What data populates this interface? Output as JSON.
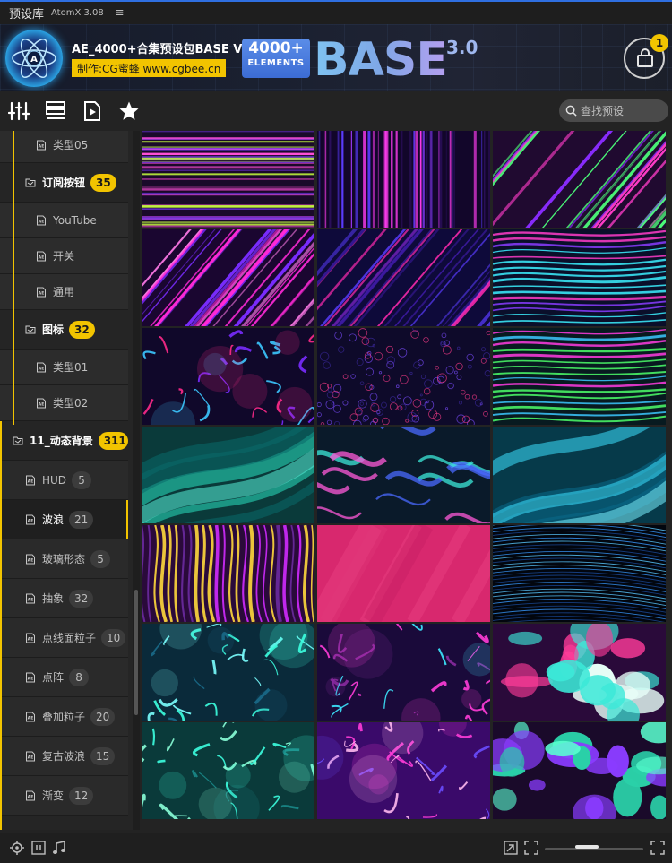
{
  "window": {
    "title": "预设库",
    "version": "AtomX 3.08",
    "menu_glyph": "≡"
  },
  "banner": {
    "logo_letter": "A",
    "title": "AE_4000+合集预设包BASE V3",
    "maker": "制作:CG蜜蜂 www.cgbee.cn",
    "tag_number": "4000+",
    "tag_word": "ELEMENTS",
    "base_word": "BASE",
    "base_version": "3.0",
    "cart_badge": "1"
  },
  "toolbar": {
    "icons": [
      "sliders-icon",
      "list-icon",
      "play-icon",
      "star-icon"
    ],
    "search_placeholder": "查找预设"
  },
  "sidebar": {
    "items": [
      {
        "label": "类型05",
        "level": "sub",
        "count": ""
      },
      {
        "label": "订阅按钮",
        "level": "group",
        "count": "35"
      },
      {
        "label": "YouTube",
        "level": "sub",
        "count": ""
      },
      {
        "label": "开关",
        "level": "sub",
        "count": ""
      },
      {
        "label": "通用",
        "level": "sub",
        "count": ""
      },
      {
        "label": "图标",
        "level": "group",
        "count": "32"
      },
      {
        "label": "类型01",
        "level": "sub",
        "count": ""
      },
      {
        "label": "类型02",
        "level": "sub",
        "count": ""
      },
      {
        "label": "11_动态背景",
        "level": "group",
        "count": "311"
      },
      {
        "label": "HUD",
        "level": "cat",
        "count": "5"
      },
      {
        "label": "波浪",
        "level": "cat",
        "count": "21",
        "selected": true
      },
      {
        "label": "玻璃形态",
        "level": "cat",
        "count": "5"
      },
      {
        "label": "抽象",
        "level": "cat",
        "count": "32"
      },
      {
        "label": "点线面粒子",
        "level": "cat",
        "count": "10"
      },
      {
        "label": "点阵",
        "level": "cat",
        "count": "8"
      },
      {
        "label": "叠加粒子",
        "level": "cat",
        "count": "20"
      },
      {
        "label": "复古波浪",
        "level": "cat",
        "count": "15"
      },
      {
        "label": "渐变",
        "level": "cat",
        "count": "12"
      }
    ]
  },
  "grid": {
    "thumbnails": [
      {
        "style": "h-streaks",
        "colors": [
          "#1a0a2a",
          "#7d3cff",
          "#c6ff3c",
          "#ff4fd8"
        ]
      },
      {
        "style": "v-streaks",
        "colors": [
          "#12062a",
          "#ff3cf0",
          "#5b3cff",
          "#2a0f5a"
        ]
      },
      {
        "style": "diag-streaks",
        "colors": [
          "#200a30",
          "#ff3cc8",
          "#4cff7a",
          "#8a2cff"
        ]
      },
      {
        "style": "diag-streaks",
        "colors": [
          "#1a0630",
          "#ff2ad8",
          "#7a2cff",
          "#ff7ae8"
        ]
      },
      {
        "style": "diag-streaks",
        "colors": [
          "#0e0a3a",
          "#ff2ab0",
          "#5a3cff",
          "#3c1aa0"
        ]
      },
      {
        "style": "h-waves",
        "colors": [
          "#0a0f2a",
          "#ff3cc8",
          "#3cf0ff",
          "#8a3cff"
        ]
      },
      {
        "style": "cells",
        "colors": [
          "#10082a",
          "#3cc8ff",
          "#ff2a8a",
          "#7a2cff"
        ]
      },
      {
        "style": "noise",
        "colors": [
          "#0e0a2a",
          "#7a4cff",
          "#ff3c8a",
          "#3c2aa0"
        ]
      },
      {
        "style": "h-waves",
        "colors": [
          "#081a20",
          "#4cff6a",
          "#3cc8ff",
          "#ff3ce0"
        ]
      },
      {
        "style": "soft-bands",
        "colors": [
          "#0a3a3a",
          "#2ae0c0",
          "#0a6a6a",
          "#58f0d8"
        ]
      },
      {
        "style": "swirl",
        "colors": [
          "#0a1a2a",
          "#3ce8d8",
          "#ff5ad8",
          "#4a6aff"
        ]
      },
      {
        "style": "soft-bands",
        "colors": [
          "#063a4a",
          "#3ce0ff",
          "#0a6a8a",
          "#7af0ff"
        ]
      },
      {
        "style": "v-waves",
        "colors": [
          "#2a0a3a",
          "#ffd83c",
          "#d02aff",
          "#6a2aa0"
        ]
      },
      {
        "style": "flat",
        "colors": [
          "#d8286e",
          "#e23a7a",
          "#c41c60",
          "#f04a88"
        ]
      },
      {
        "style": "fine-lines",
        "colors": [
          "#02060e",
          "#3a9aff",
          "#1a4a9a",
          "#5ac8ff"
        ]
      },
      {
        "style": "cells",
        "colors": [
          "#0a2a3a",
          "#3cffe0",
          "#1a6a8a",
          "#7affff"
        ]
      },
      {
        "style": "cells",
        "colors": [
          "#1a0a3a",
          "#ff3cd8",
          "#3ce8ff",
          "#8a2aa0"
        ]
      },
      {
        "style": "blobs",
        "colors": [
          "#2a0a3a",
          "#e8fff8",
          "#3ce8d8",
          "#ff3c9a"
        ]
      },
      {
        "style": "cells",
        "colors": [
          "#0a3a3a",
          "#3cffe0",
          "#1a8a8a",
          "#8affd8"
        ]
      },
      {
        "style": "cells",
        "colors": [
          "#3a0a6a",
          "#ff3cd8",
          "#6a4cff",
          "#ffb8f0"
        ]
      },
      {
        "style": "blobs",
        "colors": [
          "#1a0a2a",
          "#5affd0",
          "#2ad0a8",
          "#8a3cff"
        ]
      }
    ]
  },
  "bottombar": {
    "icons": [
      "target-icon",
      "pause-icon",
      "music-icon",
      "shrink-icon",
      "expand-icon",
      "fullscreen-icon"
    ],
    "zoom_level": 0.4
  }
}
